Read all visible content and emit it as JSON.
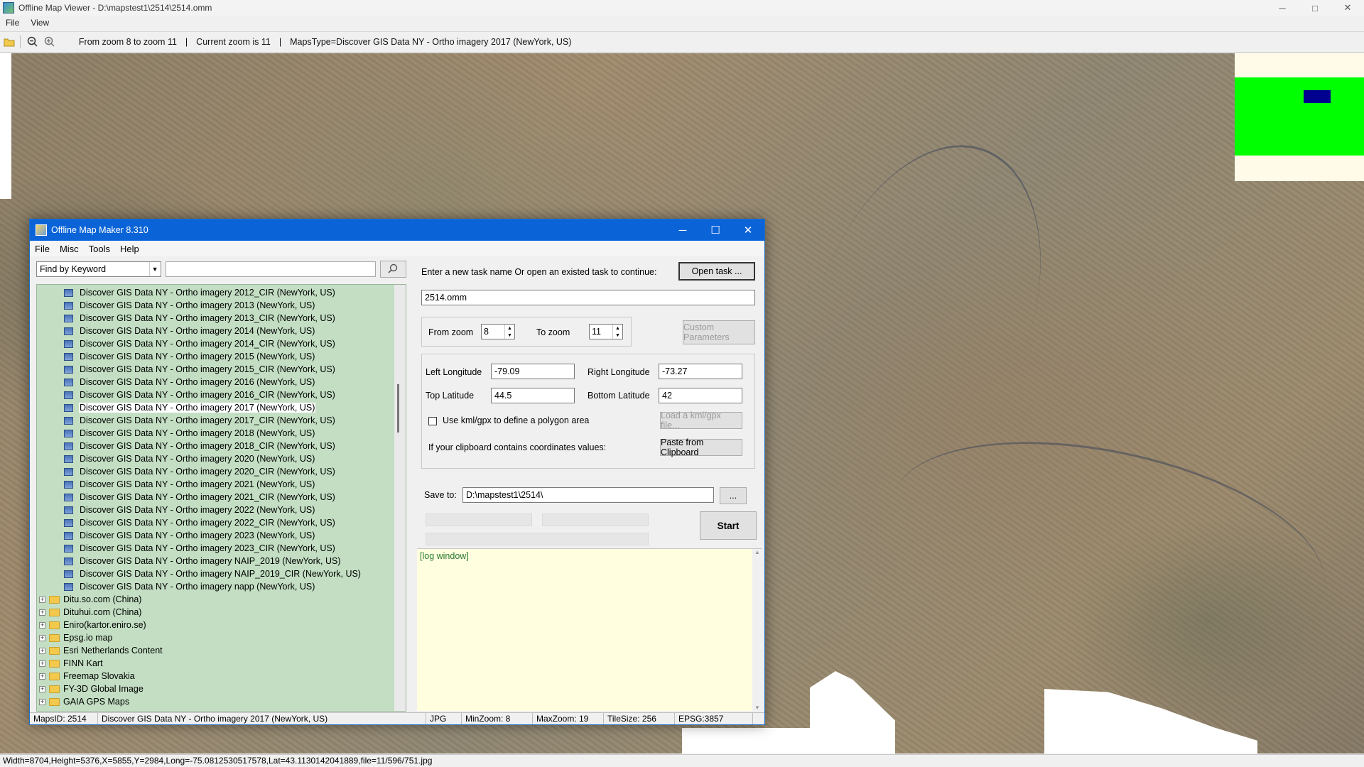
{
  "main": {
    "title": "Offline Map Viewer - D:\\mapstest1\\2514\\2514.omm",
    "menu": [
      "File",
      "View"
    ],
    "controls": {
      "minimize": "─",
      "maximize": "□",
      "close": "✕"
    },
    "toolbar": {
      "zoom_range": "From zoom 8 to zoom 11",
      "separator": "|",
      "current_zoom": "Current zoom is 11",
      "maps_type": "MapsType=Discover GIS Data NY - Ortho imagery 2017 (NewYork, US)"
    },
    "status": "Width=8704,Height=5376,X=5855,Y=2984,Long=-75.0812530517578,Lat=43.1130142041889,file=11/596/751.jpg"
  },
  "dialog": {
    "title": "Offline Map Maker 8.310",
    "menu": [
      "File",
      "Misc",
      "Tools",
      "Help"
    ],
    "controls": {
      "minimize": "─",
      "maximize": "☐",
      "close": "✕"
    },
    "search": {
      "combo": "Find by Keyword",
      "keyword": ""
    },
    "tree_leaves": [
      "Discover GIS Data NY - Ortho imagery 2012_CIR (NewYork, US)",
      "Discover GIS Data NY - Ortho imagery 2013 (NewYork, US)",
      "Discover GIS Data NY - Ortho imagery 2013_CIR (NewYork, US)",
      "Discover GIS Data NY - Ortho imagery 2014 (NewYork, US)",
      "Discover GIS Data NY - Ortho imagery 2014_CIR (NewYork, US)",
      "Discover GIS Data NY - Ortho imagery 2015 (NewYork, US)",
      "Discover GIS Data NY - Ortho imagery 2015_CIR (NewYork, US)",
      "Discover GIS Data NY - Ortho imagery 2016 (NewYork, US)",
      "Discover GIS Data NY - Ortho imagery 2016_CIR (NewYork, US)",
      "Discover GIS Data NY - Ortho imagery 2017 (NewYork, US)",
      "Discover GIS Data NY - Ortho imagery 2017_CIR (NewYork, US)",
      "Discover GIS Data NY - Ortho imagery 2018 (NewYork, US)",
      "Discover GIS Data NY - Ortho imagery 2018_CIR (NewYork, US)",
      "Discover GIS Data NY - Ortho imagery 2020 (NewYork, US)",
      "Discover GIS Data NY - Ortho imagery 2020_CIR (NewYork, US)",
      "Discover GIS Data NY - Ortho imagery 2021 (NewYork, US)",
      "Discover GIS Data NY - Ortho imagery 2021_CIR (NewYork, US)",
      "Discover GIS Data NY - Ortho imagery 2022 (NewYork, US)",
      "Discover GIS Data NY - Ortho imagery 2022_CIR (NewYork, US)",
      "Discover GIS Data NY - Ortho imagery 2023 (NewYork, US)",
      "Discover GIS Data NY - Ortho imagery 2023_CIR (NewYork, US)",
      "Discover GIS Data NY - Ortho imagery NAIP_2019 (NewYork, US)",
      "Discover GIS Data NY - Ortho imagery NAIP_2019_CIR (NewYork, US)",
      "Discover GIS Data NY - Ortho imagery napp (NewYork, US)"
    ],
    "tree_selected": "Discover GIS Data NY - Ortho imagery 2017 (NewYork, US)",
    "tree_folders": [
      "Ditu.so.com (China)",
      "Dituhui.com (China)",
      "Eniro(kartor.eniro.se)",
      "Epsg.io map",
      "Esri Netherlands Content",
      "FINN Kart",
      "Freemap Slovakia",
      "FY-3D Global Image",
      "GAIA GPS Maps"
    ],
    "form": {
      "task_prompt": "Enter a new task name Or open an existed task to continue:",
      "open_task": "Open task ...",
      "task_name": "2514.omm",
      "from_zoom_label": "From zoom",
      "from_zoom": "8",
      "to_zoom_label": "To zoom",
      "to_zoom": "11",
      "custom_params": "Custom Parameters",
      "left_lon_label": "Left Longitude",
      "left_lon": "-79.09",
      "right_lon_label": "Right Longitude",
      "right_lon": "-73.27",
      "top_lat_label": "Top Latitude",
      "top_lat": "44.5",
      "bottom_lat_label": "Bottom Latitude",
      "bottom_lat": "42",
      "kml_label": "Use kml/gpx to define a polygon area",
      "kml_button": "Load a kml/gpx file...",
      "clipboard_label": "If your clipboard contains coordinates values:",
      "clipboard_button": "Paste from Clipboard",
      "save_label": "Save to:",
      "save_path": "D:\\mapstest1\\2514\\",
      "browse": "...",
      "start": "Start"
    },
    "log_title": "[log window]",
    "status": {
      "maps_id": "MapsID: 2514",
      "map_name": "Discover GIS Data NY - Ortho imagery 2017 (NewYork, US)",
      "format": "JPG",
      "min_zoom": "MinZoom: 8",
      "max_zoom": "MaxZoom: 19",
      "tile_size": "TileSize: 256",
      "epsg": "EPSG:3857"
    }
  },
  "colors": {
    "dialog_title": "#0a64d8",
    "tree_bg": "#c3dec3",
    "log_bg": "#ffffe0",
    "minimap_green": "#00ff00",
    "minimap_blue": "#000090"
  }
}
